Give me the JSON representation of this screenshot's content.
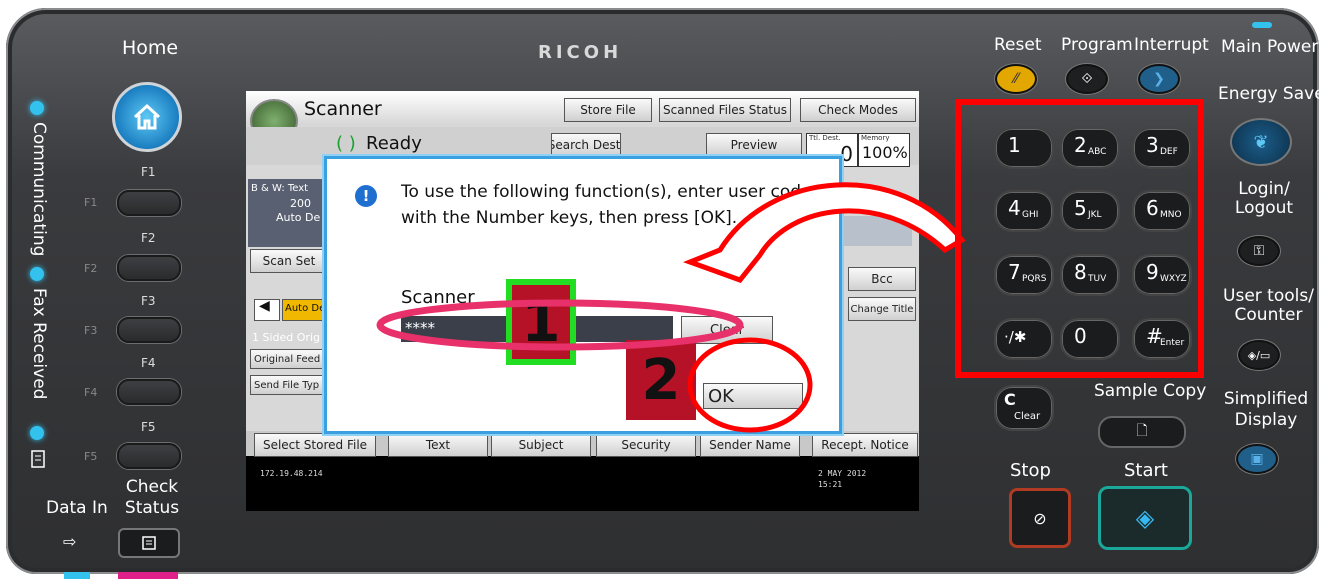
{
  "brand": "RICOH",
  "left": {
    "home": "Home",
    "communicating": "Communicating",
    "fax_received": "Fax Received",
    "fkeys": [
      {
        "side": "F1",
        "label": "F1"
      },
      {
        "side": "F2",
        "label": "F2"
      },
      {
        "side": "F3",
        "label": "F3"
      },
      {
        "side": "F4",
        "label": "F4"
      },
      {
        "side": "F5",
        "label": "F5"
      }
    ],
    "data_in": "Data In",
    "check_status": "Check Status"
  },
  "right": {
    "reset": "Reset",
    "program": "Program",
    "interrupt": "Interrupt",
    "main_power": "Main Power",
    "energy_saver": "Energy Saver",
    "login_logout": "Login/ Logout",
    "user_tools": "User tools/ Counter",
    "simplified_display": "Simplified Display",
    "sample_copy": "Sample Copy",
    "stop": "Stop",
    "start": "Start",
    "clear_key": "C",
    "clear_sub": "Clear",
    "keys": [
      {
        "d": "1",
        "s": ""
      },
      {
        "d": "2",
        "s": "ABC"
      },
      {
        "d": "3",
        "s": "DEF"
      },
      {
        "d": "4",
        "s": "GHI"
      },
      {
        "d": "5",
        "s": "JKL"
      },
      {
        "d": "6",
        "s": "MNO"
      },
      {
        "d": "7",
        "s": "PQRS"
      },
      {
        "d": "8",
        "s": "TUV"
      },
      {
        "d": "9",
        "s": "WXYZ"
      },
      {
        "d": "·/✱",
        "s": ""
      },
      {
        "d": "0",
        "s": ""
      },
      {
        "d": "#",
        "s": "Enter"
      }
    ]
  },
  "screen": {
    "app": "Scanner",
    "status": "Ready",
    "store_file": "Store File",
    "scanned_files_status": "Scanned Files Status",
    "check_modes": "Check Modes",
    "search_dest": "Search Dest.",
    "preview": "Preview",
    "ttl_dest": "Ttl. Dest.",
    "memory": "Memory",
    "ttl_value": "0",
    "memory_value": "100%",
    "settings_1": "B & W: Text",
    "settings_2": "200",
    "settings_3": "Auto De",
    "scan_set": "Scan Set",
    "auto_den": "Auto Den",
    "sided_orig": "1 Sided Orig",
    "original_feed": "Original Feed T",
    "send_file_type": "Send File Typ",
    "bcc": "Bcc",
    "change_title": "Change Title",
    "bottom_tabs": [
      "Select Stored File",
      "Text",
      "Subject",
      "Security",
      "Sender Name",
      "Recept. Notice"
    ],
    "ip": "172.19.48.214",
    "date": "2 MAY  2012",
    "time": "15:21"
  },
  "dialog": {
    "message": "To use the following function(s), enter user code with the Number keys, then press [OK].",
    "field_label": "Scanner",
    "field_value": "****",
    "clear_button": "Clear",
    "ok_button": "OK"
  },
  "annotations": {
    "step1": "1",
    "step2": "2"
  }
}
